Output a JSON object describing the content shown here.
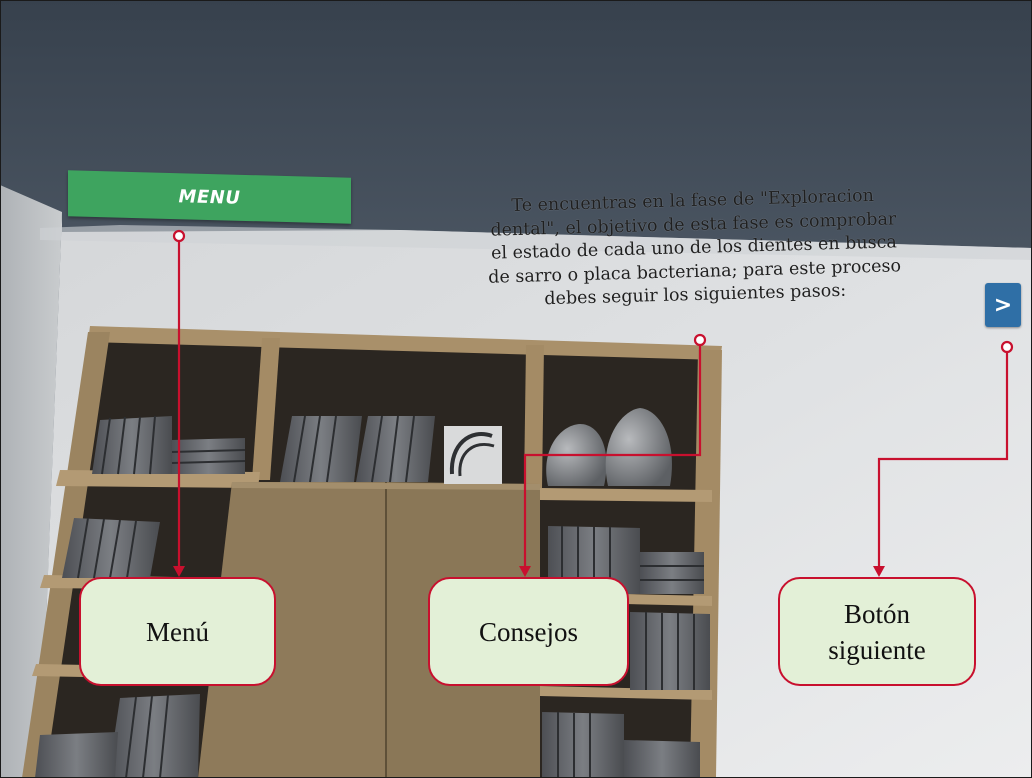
{
  "hud": {
    "menu_label": "MENU",
    "advice_lines": [
      "Te encuentras en la fase de \"Exploracion",
      "dental\", el objetivo de esta fase es comprobar",
      "el estado de cada uno de los dientes en busca",
      "de sarro o placa bacteriana; para este proceso",
      "debes seguir los siguientes pasos:"
    ],
    "next_label": ">"
  },
  "callouts": {
    "menu": "Menú",
    "tips": "Consejos",
    "next_line1": "Botón",
    "next_line2": "siguiente"
  },
  "colors": {
    "menu_green": "#3ea45f",
    "next_blue": "#2f6fa6",
    "callout_fill": "#e3f0d7",
    "annotation_red": "#c8102e"
  }
}
